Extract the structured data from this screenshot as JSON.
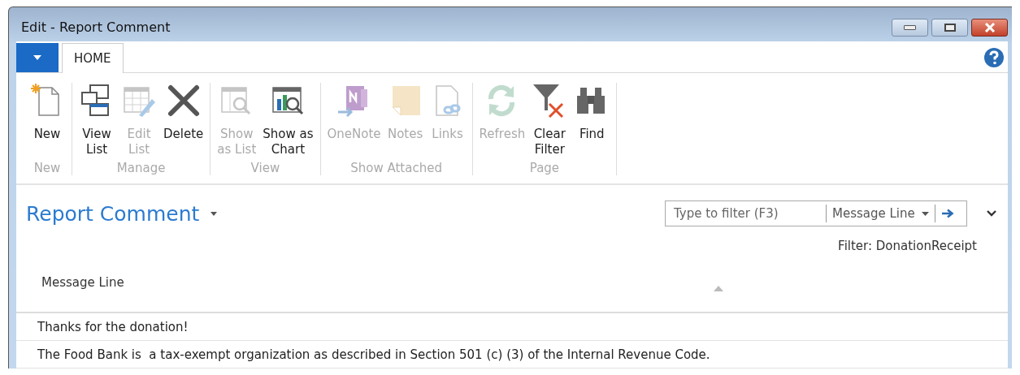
{
  "window": {
    "title": "Edit - Report Comment"
  },
  "tabs": [
    {
      "label": "HOME",
      "selected": true
    }
  ],
  "ribbon": {
    "groups": [
      {
        "label": "New",
        "buttons": [
          {
            "kind": "new",
            "label": [
              "New"
            ],
            "disabled": false
          }
        ]
      },
      {
        "label": "Manage",
        "buttons": [
          {
            "kind": "view-list",
            "label": [
              "View",
              "List"
            ],
            "disabled": false
          },
          {
            "kind": "edit-list",
            "label": [
              "Edit",
              "List"
            ],
            "disabled": true
          },
          {
            "kind": "delete",
            "label": [
              "Delete"
            ],
            "disabled": false
          }
        ]
      },
      {
        "label": "View",
        "buttons": [
          {
            "kind": "show-list",
            "label": [
              "Show",
              "as List"
            ],
            "disabled": true
          },
          {
            "kind": "show-chart",
            "label": [
              "Show as",
              "Chart"
            ],
            "disabled": false
          }
        ]
      },
      {
        "label": "Show Attached",
        "buttons": [
          {
            "kind": "onenote",
            "label": [
              "OneNote"
            ],
            "disabled": true
          },
          {
            "kind": "notes",
            "label": [
              "Notes"
            ],
            "disabled": true
          },
          {
            "kind": "links",
            "label": [
              "Links"
            ],
            "disabled": true
          }
        ]
      },
      {
        "label": "Page",
        "buttons": [
          {
            "kind": "refresh",
            "label": [
              "Refresh"
            ],
            "disabled": true
          },
          {
            "kind": "clear-filter",
            "label": [
              "Clear",
              "Filter"
            ],
            "disabled": false
          },
          {
            "kind": "find",
            "label": [
              "Find"
            ],
            "disabled": false
          }
        ]
      }
    ]
  },
  "page": {
    "title": "Report Comment",
    "filter_box": {
      "placeholder": "Type to filter (F3)",
      "field": "Message Line"
    },
    "filter_text": "Filter: DonationReceipt"
  },
  "table": {
    "columns": [
      "Message Line"
    ],
    "rows": [
      [
        "Thanks for the donation!"
      ],
      [
        "The Food Bank is  a tax-exempt organization as described in Section 501 (c) (3) of the Internal Revenue Code."
      ]
    ]
  }
}
